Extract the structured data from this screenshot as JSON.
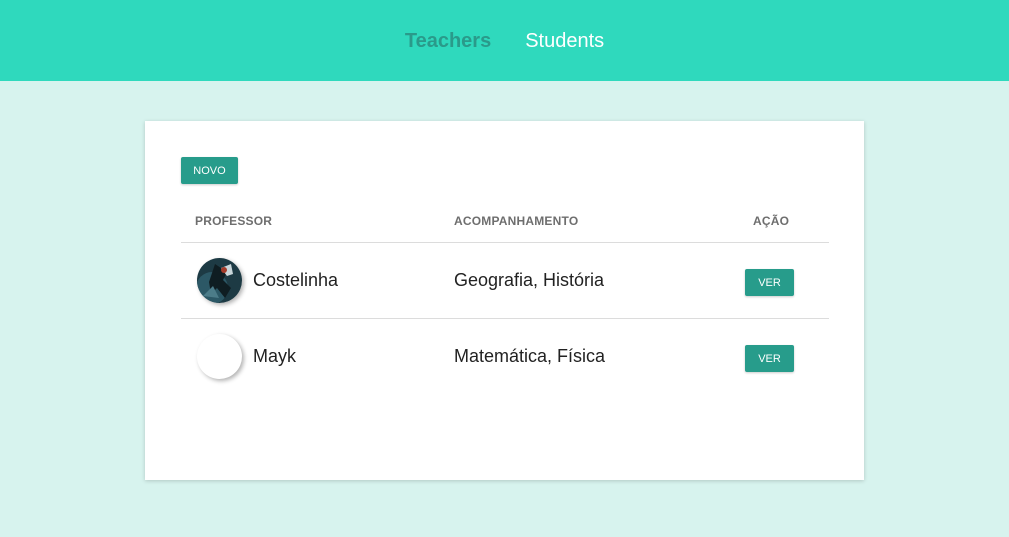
{
  "nav": {
    "links": [
      {
        "label": "Teachers",
        "active": true
      },
      {
        "label": "Students",
        "active": false
      }
    ]
  },
  "card": {
    "new_button": "NOVO",
    "headers": {
      "professor": "PROFESSOR",
      "acompanhamento": "ACOMPANHAMENTO",
      "acao": "AÇÃO"
    },
    "rows": [
      {
        "name": "Costelinha",
        "subjects": "Geografia, História",
        "action": "VER",
        "avatar": "photo"
      },
      {
        "name": "Mayk",
        "subjects": "Matemática, Física",
        "action": "VER",
        "avatar": "blank"
      }
    ]
  },
  "colors": {
    "header_bg": "#2fd9bd",
    "page_bg": "#d7f3ee",
    "active_link": "#2a9a8a",
    "button": "#279c8b"
  }
}
